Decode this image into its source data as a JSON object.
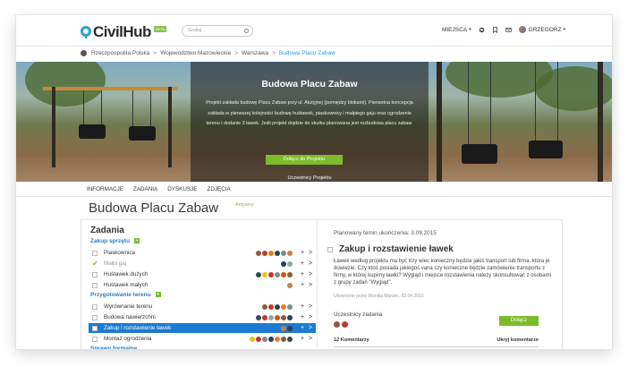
{
  "header": {
    "logo_text": "CivilHub",
    "beta": "BETA",
    "search_placeholder": "Szukaj...",
    "nav_places": "MIEJSCA",
    "user_name": "GRZEGORZ"
  },
  "breadcrumb": {
    "items": [
      "Rzeczpospolita Polska",
      "Województwo Mazowieckie",
      "Warszawa"
    ],
    "current": "Budowa Placu Zabaw",
    "separator": ">"
  },
  "hero": {
    "title": "Budowa Placu Zabaw",
    "description": "Projekt zakłada budowę Placu Zabaw przy ul. Atutyjnej (pomiędzy blokami). Pierwotna koncepcja zakłada w pierwszej kolejności budowę huśtawek, piaskownicy i małpiego gaju oraz ogrodzenie terenu i dodanie 3 ławek. Jeśli projekt dojdzie do skutku planowana jest rozbudowa placu zabaw.",
    "join_label": "Dołącz do Projektu",
    "members_label": "Uczestnicy Projektu",
    "member_colors": [
      "#c0392b",
      "#e67e22",
      "#f1c40f",
      "#27ae60",
      "#2980b9",
      "#8e44ad",
      "#d35400",
      "#16a085",
      "#7f8c8d",
      "#c0392b",
      "#2c3e50",
      "#e74c3c",
      "#3498db",
      "#9b59b6",
      "#1abc9c",
      "#f39c12",
      "#34495e",
      "#e67e22",
      "#95a5a6",
      "#c0392b",
      "#2980b9",
      "#27ae60",
      "#d35400",
      "#8e44ad",
      "#f1c40f",
      "#16a085",
      "#2c3e50",
      "#e74c3c",
      "#3498db",
      "#7f8c8d",
      "#9b59b6",
      "#1abc9c",
      "#f39c12",
      "#34495e",
      "#c0392b",
      "#e67e22",
      "#27ae60",
      "#2980b9",
      "#d35400",
      "#8e44ad",
      "#95a5a6",
      "#16a085",
      "#e74c3c",
      "#3498db",
      "#f1c40f",
      "#2c3e50",
      "#9b59b6",
      "#1abc9c",
      "#e67e22",
      "#c0392b",
      "#27ae60",
      "#2980b9",
      "#d35400",
      "#8e44ad",
      "#7f8c8d",
      "#16a085",
      "#e74c3c",
      "#3498db",
      "#34495e",
      "#f39c12",
      "#9b59b6",
      "#1abc9c",
      "#c0392b",
      "#2980b9"
    ]
  },
  "tabs": [
    "INFORMACJE",
    "ZADANIA",
    "DYSKUSJE",
    "ZDJĘCIA"
  ],
  "project": {
    "title": "Budowa Placu Zabaw",
    "status": "Aktywny"
  },
  "tasks_panel": {
    "heading": "Zadania",
    "groups": [
      {
        "name": "Zakup sprzętu",
        "plus": "+",
        "tasks": [
          {
            "label": "Piaskownica",
            "done": false,
            "selected": false,
            "avatars": [
              "#8e5a3c",
              "#c0392b",
              "#e67e22",
              "#2c3e50",
              "#7f8c8d",
              "#c97f4a"
            ]
          },
          {
            "label": "Małpi gaj",
            "done": true,
            "selected": false,
            "avatars": [
              "#2c3e50",
              "#95a5a6"
            ]
          },
          {
            "label": "Huśtawek dużych",
            "done": false,
            "selected": false,
            "avatars": [
              "#34495e",
              "#f1c40f",
              "#c0392b",
              "#7f8c8d",
              "#d35400",
              "#8e5a3c"
            ]
          },
          {
            "label": "Huśtawek małych",
            "done": false,
            "selected": false,
            "avatars": [
              "#c97f4a"
            ]
          }
        ]
      },
      {
        "name": "Przygotowanie terenu",
        "plus": "+",
        "tasks": [
          {
            "label": "Wyrównanie terenu",
            "done": false,
            "selected": false,
            "avatars": [
              "#8e5a3c",
              "#c0392b",
              "#2c3e50",
              "#e67e22",
              "#7f8c8d"
            ]
          },
          {
            "label": "Budowa nawierzchni",
            "done": false,
            "selected": false,
            "avatars": [
              "#34495e",
              "#c0392b",
              "#95a5a6",
              "#d35400",
              "#8e5a3c",
              "#2c3e50"
            ]
          },
          {
            "label": "Zakup i rozstawienie ławek",
            "done": false,
            "selected": true,
            "avatars": [
              "#c97f4a",
              "#2c3e50"
            ]
          },
          {
            "label": "Montaż ogrodzenia",
            "done": false,
            "selected": false,
            "avatars": [
              "#f1c40f",
              "#c0392b",
              "#7f8c8d",
              "#2c3e50",
              "#e67e22",
              "#8e5a3c",
              "#34495e"
            ]
          }
        ]
      },
      {
        "name": "Sprawy formalne",
        "plus": "",
        "tasks": []
      }
    ],
    "action_add": "+",
    "action_open": ">"
  },
  "task_detail": {
    "deadline": "Planowany temin ukończenia: 3.09.2015",
    "title": "Zakup i rozstawienie ławek",
    "description": "Ławek według projektu ma być trzy wiec konieczny będzie jakiś transport lub firma, która je dowiezie. Czy ktoś posiada jakiegoś vana czy konieczne będzie zamówienie transportu z firmy, w której kupimy ławki? Wygląd i miejsce rozstawienia należy skonsultować z osobami z grupy zadań \"Wygląd\".",
    "meta": "Utworzone przez Monika Marzec, 02.04.2015",
    "members_label": "Uczestnicy zadania",
    "member_colors": [
      "#8e5a3c",
      "#c0392b"
    ],
    "join_label": "Dołącz",
    "comments_label": "12 Komentarzy",
    "hide_comments_label": "Ukryj komentarze"
  }
}
